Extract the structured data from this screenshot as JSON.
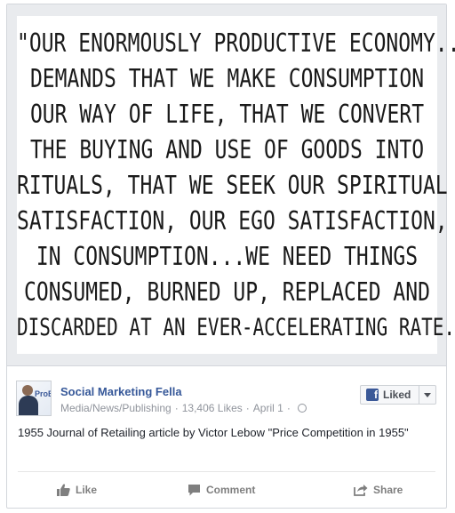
{
  "post": {
    "image_quote_lines": [
      "\"OUR ENORMOUSLY PRODUCTIVE ECONOMY...",
      "DEMANDS THAT WE MAKE CONSUMPTION",
      "OUR WAY OF LIFE, THAT WE CONVERT",
      "THE BUYING AND USE OF GOODS INTO",
      "RITUALS, THAT WE SEEK OUR SPIRITUAL",
      "SATISFACTION, OUR EGO SATISFACTION,",
      "IN CONSUMPTION...WE NEED THINGS",
      "CONSUMED, BURNED UP, REPLACED AND",
      "DISCARDED AT AN EVER-ACCELERATING RATE.\""
    ],
    "avatar_text": "ProB",
    "page_name": "Social Marketing Fella",
    "category": "Media/News/Publishing",
    "likes": "13,406 Likes",
    "date": "April 1",
    "meta_separator": "·",
    "like_button_label": "Liked",
    "text": "1955 Journal of Retailing article by Victor Lebow \"Price Competition in 1955\"",
    "actions": {
      "like": "Like",
      "comment": "Comment",
      "share": "Share"
    },
    "colors": {
      "link": "#365899",
      "fb_blue": "#3b5998",
      "muted": "#90949c"
    },
    "icons": [
      "thumbs-up-icon",
      "comment-icon",
      "share-icon",
      "globe-icon",
      "facebook-icon",
      "chevron-down-icon"
    ]
  }
}
